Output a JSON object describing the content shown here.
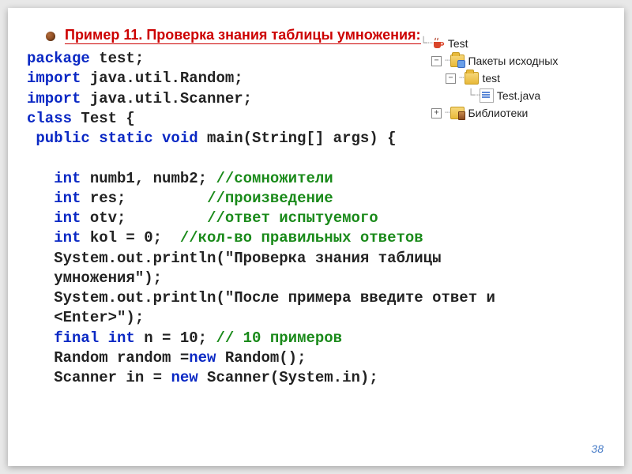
{
  "title": "Пример  11. Проверка знания таблицы умножения:",
  "tree": {
    "root": "Test",
    "sources": "Пакеты исходных",
    "pkg": "test",
    "file": "Test.java",
    "libs": "Библиотеки"
  },
  "code": {
    "l1_kw": "package",
    "l1_r": " test;",
    "l2_kw": "import",
    "l2_r": " java.util.Random;",
    "l3_kw": "import",
    "l3_r": " java.util.Scanner;",
    "l4_kw": "class",
    "l4_r": " Test {",
    "l5_kw": " public static void",
    "l5_r": " main(String[] args) {",
    "blank": "",
    "l6_kw": "   int",
    "l6_r": " numb1, numb2; ",
    "l6_c": "//сомножители",
    "l7_kw": "   int",
    "l7_r": " res;         ",
    "l7_c": "//произведение",
    "l8_kw": "   int",
    "l8_r": " otv;         ",
    "l8_c": "//ответ испытуемого",
    "l9_kw": "   int",
    "l9_r": " kol = 0;  ",
    "l9_c": "//кол-во правильных ответов",
    "l10": "   System.out.println(\"Проверка знания таблицы",
    "l11": "   умножения\");",
    "l12": "   System.out.println(\"После примера введите ответ и",
    "l13": "   <Enter>\");",
    "l14_kw": "   final int",
    "l14_r": " n = 10; ",
    "l14_c": "// 10 примеров",
    "l15_r": "   Random random =",
    "l15_kw": "new",
    "l15_r2": " Random();",
    "l16_r": "   Scanner in = ",
    "l16_kw": "new",
    "l16_r2": " Scanner(System.in);"
  },
  "page_number": "38"
}
